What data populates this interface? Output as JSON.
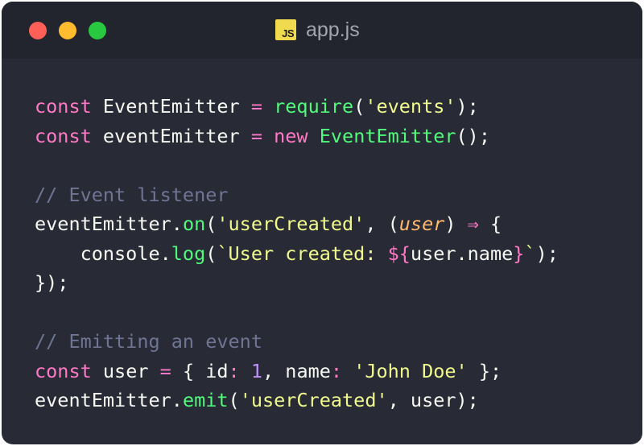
{
  "window": {
    "title": "app.js",
    "icon_label": "JS",
    "controls": [
      "close",
      "minimize",
      "maximize"
    ]
  },
  "colors": {
    "background": "#282a36",
    "titlebar": "#22242e",
    "keyword": "#ff79c6",
    "function": "#50fa7b",
    "string": "#f1fa8c",
    "comment": "#6f7592",
    "parameter": "#ffb86c",
    "number": "#bd93f9",
    "plain": "#f8f8f2"
  },
  "code": {
    "lines": [
      {
        "tokens": [
          {
            "t": "kw",
            "v": "const"
          },
          {
            "t": "pl",
            "v": " EventEmitter "
          },
          {
            "t": "op",
            "v": "="
          },
          {
            "t": "pl",
            "v": " "
          },
          {
            "t": "fn",
            "v": "require"
          },
          {
            "t": "pl",
            "v": "("
          },
          {
            "t": "str",
            "v": "'events'"
          },
          {
            "t": "pl",
            "v": ");"
          }
        ]
      },
      {
        "tokens": [
          {
            "t": "kw",
            "v": "const"
          },
          {
            "t": "pl",
            "v": " eventEmitter "
          },
          {
            "t": "op",
            "v": "="
          },
          {
            "t": "pl",
            "v": " "
          },
          {
            "t": "kw",
            "v": "new"
          },
          {
            "t": "pl",
            "v": " "
          },
          {
            "t": "fn",
            "v": "EventEmitter"
          },
          {
            "t": "pl",
            "v": "();"
          }
        ]
      },
      {
        "tokens": []
      },
      {
        "tokens": [
          {
            "t": "cm",
            "v": "// Event listener"
          }
        ]
      },
      {
        "tokens": [
          {
            "t": "pl",
            "v": "eventEmitter."
          },
          {
            "t": "fn",
            "v": "on"
          },
          {
            "t": "pl",
            "v": "("
          },
          {
            "t": "str",
            "v": "'userCreated'"
          },
          {
            "t": "pl",
            "v": ", ("
          },
          {
            "t": "param",
            "v": "user"
          },
          {
            "t": "pl",
            "v": ") "
          },
          {
            "t": "op",
            "v": "⇒"
          },
          {
            "t": "pl",
            "v": " {"
          }
        ]
      },
      {
        "tokens": [
          {
            "t": "pl",
            "v": "    console."
          },
          {
            "t": "fn",
            "v": "log"
          },
          {
            "t": "pl",
            "v": "("
          },
          {
            "t": "str",
            "v": "`User created: "
          },
          {
            "t": "kw",
            "v": "${"
          },
          {
            "t": "pl",
            "v": "user.name"
          },
          {
            "t": "kw",
            "v": "}"
          },
          {
            "t": "str",
            "v": "`"
          },
          {
            "t": "pl",
            "v": ");"
          }
        ]
      },
      {
        "tokens": [
          {
            "t": "pl",
            "v": "});"
          }
        ]
      },
      {
        "tokens": []
      },
      {
        "tokens": [
          {
            "t": "cm",
            "v": "// Emitting an event"
          }
        ]
      },
      {
        "tokens": [
          {
            "t": "kw",
            "v": "const"
          },
          {
            "t": "pl",
            "v": " user "
          },
          {
            "t": "op",
            "v": "="
          },
          {
            "t": "pl",
            "v": " { id"
          },
          {
            "t": "op",
            "v": ":"
          },
          {
            "t": "pl",
            "v": " "
          },
          {
            "t": "num",
            "v": "1"
          },
          {
            "t": "pl",
            "v": ", name"
          },
          {
            "t": "op",
            "v": ":"
          },
          {
            "t": "pl",
            "v": " "
          },
          {
            "t": "str",
            "v": "'John Doe'"
          },
          {
            "t": "pl",
            "v": " };"
          }
        ]
      },
      {
        "tokens": [
          {
            "t": "pl",
            "v": "eventEmitter."
          },
          {
            "t": "fn",
            "v": "emit"
          },
          {
            "t": "pl",
            "v": "("
          },
          {
            "t": "str",
            "v": "'userCreated'"
          },
          {
            "t": "pl",
            "v": ", user);"
          }
        ]
      }
    ]
  }
}
